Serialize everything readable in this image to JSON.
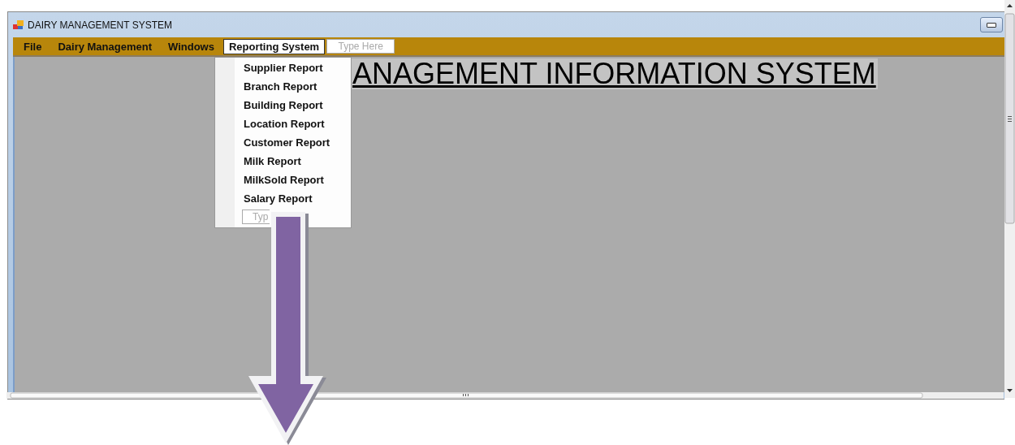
{
  "window": {
    "title": "DAIRY MANAGEMENT SYSTEM"
  },
  "menu_bar": {
    "items": [
      {
        "label": "File",
        "selected": false
      },
      {
        "label": "Dairy Management",
        "selected": false
      },
      {
        "label": "Windows",
        "selected": false
      },
      {
        "label": "Reporting System",
        "selected": true
      }
    ],
    "placeholder": "Type Here"
  },
  "heading": "ANAGEMENT INFORMATION SYSTEM",
  "dropdown": {
    "items": [
      {
        "label": "Supplier Report"
      },
      {
        "label": "Branch Report"
      },
      {
        "label": "Building Report"
      },
      {
        "label": "Location Report"
      },
      {
        "label": "Customer Report"
      },
      {
        "label": "Milk Report"
      },
      {
        "label": "MilkSold Report"
      },
      {
        "label": "Salary Report"
      }
    ],
    "placeholder": "Typ"
  }
}
